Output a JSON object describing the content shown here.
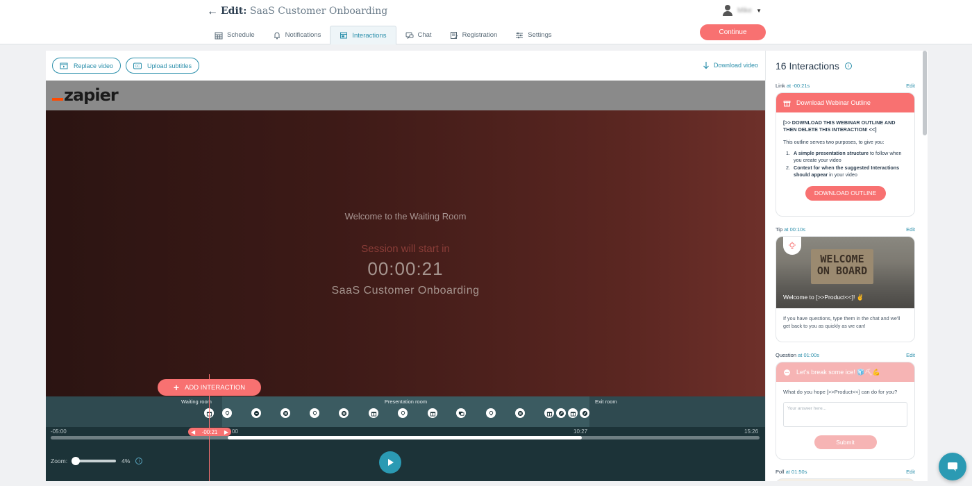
{
  "header": {
    "title_prefix": "Edit:",
    "title_name": "SaaS Customer Onboarding",
    "user_name": "Mike",
    "continue_label": "Continue"
  },
  "tabs": [
    {
      "label": "Schedule",
      "icon": "calendar-icon",
      "active": false
    },
    {
      "label": "Notifications",
      "icon": "bell-icon",
      "active": false
    },
    {
      "label": "Interactions",
      "icon": "window-icon",
      "active": true
    },
    {
      "label": "Chat",
      "icon": "chat-icon",
      "active": false
    },
    {
      "label": "Registration",
      "icon": "form-icon",
      "active": false
    },
    {
      "label": "Settings",
      "icon": "sliders-icon",
      "active": false
    }
  ],
  "toolbar": {
    "replace_video": "Replace video",
    "upload_subtitles": "Upload subtitles",
    "download_video": "Download video"
  },
  "video": {
    "logo": "zapier",
    "welcome": "Welcome to the Waiting Room",
    "session_start": "Session will start in",
    "countdown": "00:00:21",
    "event_name": "SaaS Customer Onboarding"
  },
  "add_interaction_label": "ADD INTERACTION",
  "timeline": {
    "rooms": {
      "waiting": "Waiting room",
      "presentation": "Presentation room",
      "exit": "Exit room"
    },
    "time_start": "-05:00",
    "time_zero": "00",
    "time_mid": "10:27",
    "time_end": "15:26",
    "playhead": "-00:21",
    "zoom_label": "Zoom:",
    "zoom_value": "4%",
    "progress_fraction": 0.0
  },
  "side": {
    "title": "16 Interactions",
    "items": [
      {
        "type": "Link",
        "at": "at -00:21s",
        "edit": "Edit",
        "header": "Download Webinar Outline",
        "lead": "[>> DOWNLOAD THIS WEBINAR OUTLINE AND THEN DELETE THIS INTERACTION! <<]",
        "intro": "This outline serves two purposes, to give you:",
        "point1_bold": "A simple presentation structure",
        "point1_rest": " to follow when you create your video",
        "point2_bold": "Context for when the suggested Interactions should appear",
        "point2_rest": " in your video",
        "button": "DOWNLOAD OUTLINE"
      },
      {
        "type": "Tip",
        "at": "at 00:10s",
        "edit": "Edit",
        "image_text": "WELCOME ON BOARD",
        "caption": "Welcome to [>>Product<<]! ✌️",
        "body": "If you have questions, type them in the chat and we'll get back to you as quickly as we can!"
      },
      {
        "type": "Question",
        "at": "at 01:00s",
        "edit": "Edit",
        "header": "Let's break some ice! 🧊⛏💪",
        "question": "What do you hope [>>Product<<] can do for you?",
        "placeholder": "Your answer here...",
        "button": "Submit"
      },
      {
        "type": "Poll",
        "at": "at 01:50s",
        "edit": "Edit"
      }
    ]
  }
}
